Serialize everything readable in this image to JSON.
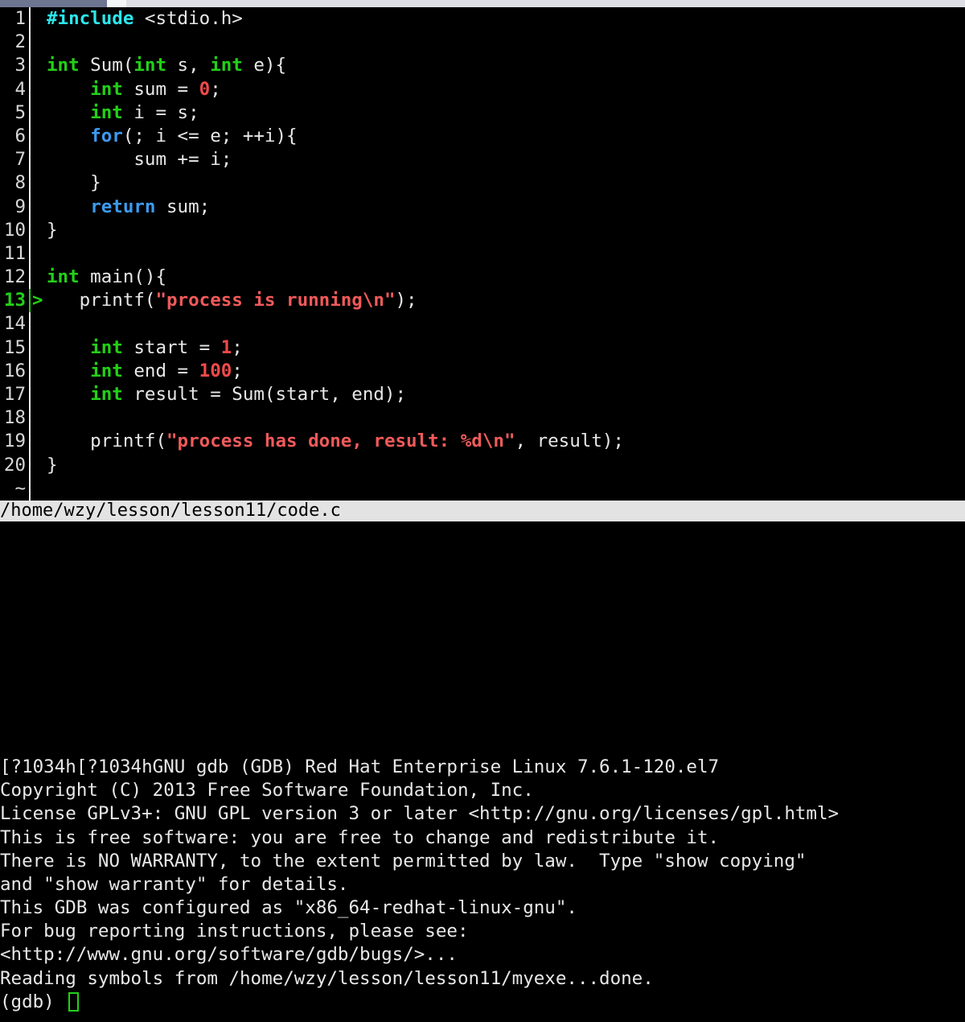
{
  "window": {
    "type": "terminal-gdb-tui",
    "background": "#000000",
    "foreground": "#e8e8e8"
  },
  "scrollbar": {
    "name": "horizontal-scrollbar",
    "thumb_color": "#6d7691",
    "track_color": "#dcdfe3"
  },
  "source_pane": {
    "file_label": "/home/wzy/lesson/lesson11/code.c",
    "current_line": 13,
    "marker": ">",
    "filler": "~",
    "lines": [
      {
        "num": "1",
        "current": false,
        "tokens": [
          {
            "c": "pre",
            "t": "#include"
          },
          {
            "c": "plain",
            "t": " <stdio.h>"
          }
        ]
      },
      {
        "num": "2",
        "current": false,
        "tokens": [
          {
            "c": "plain",
            "t": ""
          }
        ]
      },
      {
        "num": "3",
        "current": false,
        "tokens": [
          {
            "c": "type",
            "t": "int"
          },
          {
            "c": "plain",
            "t": " Sum("
          },
          {
            "c": "type",
            "t": "int"
          },
          {
            "c": "plain",
            "t": " s, "
          },
          {
            "c": "type",
            "t": "int"
          },
          {
            "c": "plain",
            "t": " e){"
          }
        ]
      },
      {
        "num": "4",
        "current": false,
        "tokens": [
          {
            "c": "plain",
            "t": "    "
          },
          {
            "c": "type",
            "t": "int"
          },
          {
            "c": "plain",
            "t": " sum = "
          },
          {
            "c": "num",
            "t": "0"
          },
          {
            "c": "plain",
            "t": ";"
          }
        ]
      },
      {
        "num": "5",
        "current": false,
        "tokens": [
          {
            "c": "plain",
            "t": "    "
          },
          {
            "c": "type",
            "t": "int"
          },
          {
            "c": "plain",
            "t": " i = s;"
          }
        ]
      },
      {
        "num": "6",
        "current": false,
        "tokens": [
          {
            "c": "plain",
            "t": "    "
          },
          {
            "c": "kw",
            "t": "for"
          },
          {
            "c": "plain",
            "t": "(; i <= e; ++i){"
          }
        ]
      },
      {
        "num": "7",
        "current": false,
        "tokens": [
          {
            "c": "plain",
            "t": "        sum += i;"
          }
        ]
      },
      {
        "num": "8",
        "current": false,
        "tokens": [
          {
            "c": "plain",
            "t": "    }"
          }
        ]
      },
      {
        "num": "9",
        "current": false,
        "tokens": [
          {
            "c": "plain",
            "t": "    "
          },
          {
            "c": "kw",
            "t": "return"
          },
          {
            "c": "plain",
            "t": " sum;"
          }
        ]
      },
      {
        "num": "10",
        "current": false,
        "tokens": [
          {
            "c": "plain",
            "t": "}"
          }
        ]
      },
      {
        "num": "11",
        "current": false,
        "tokens": [
          {
            "c": "plain",
            "t": ""
          }
        ]
      },
      {
        "num": "12",
        "current": false,
        "tokens": [
          {
            "c": "type",
            "t": "int"
          },
          {
            "c": "plain",
            "t": " main(){"
          }
        ]
      },
      {
        "num": "13",
        "current": true,
        "tokens": [
          {
            "c": "plain",
            "t": "   printf("
          },
          {
            "c": "str",
            "t": "\"process is running\\n\""
          },
          {
            "c": "plain",
            "t": ");"
          }
        ]
      },
      {
        "num": "14",
        "current": false,
        "tokens": [
          {
            "c": "plain",
            "t": ""
          }
        ]
      },
      {
        "num": "15",
        "current": false,
        "tokens": [
          {
            "c": "plain",
            "t": "    "
          },
          {
            "c": "type",
            "t": "int"
          },
          {
            "c": "plain",
            "t": " start = "
          },
          {
            "c": "num",
            "t": "1"
          },
          {
            "c": "plain",
            "t": ";"
          }
        ]
      },
      {
        "num": "16",
        "current": false,
        "tokens": [
          {
            "c": "plain",
            "t": "    "
          },
          {
            "c": "type",
            "t": "int"
          },
          {
            "c": "plain",
            "t": " end = "
          },
          {
            "c": "num",
            "t": "100"
          },
          {
            "c": "plain",
            "t": ";"
          }
        ]
      },
      {
        "num": "17",
        "current": false,
        "tokens": [
          {
            "c": "plain",
            "t": "    "
          },
          {
            "c": "type",
            "t": "int"
          },
          {
            "c": "plain",
            "t": " result = Sum(start, end);"
          }
        ]
      },
      {
        "num": "18",
        "current": false,
        "tokens": [
          {
            "c": "plain",
            "t": ""
          }
        ]
      },
      {
        "num": "19",
        "current": false,
        "tokens": [
          {
            "c": "plain",
            "t": "    printf("
          },
          {
            "c": "str",
            "t": "\"process has done, result: %d\\n\""
          },
          {
            "c": "plain",
            "t": ", result);"
          }
        ]
      },
      {
        "num": "20",
        "current": false,
        "tokens": [
          {
            "c": "plain",
            "t": "}"
          }
        ]
      }
    ]
  },
  "console": {
    "lines": [
      "[?1034h[?1034hGNU gdb (GDB) Red Hat Enterprise Linux 7.6.1-120.el7",
      "Copyright (C) 2013 Free Software Foundation, Inc.",
      "License GPLv3+: GNU GPL version 3 or later <http://gnu.org/licenses/gpl.html>",
      "This is free software: you are free to change and redistribute it.",
      "There is NO WARRANTY, to the extent permitted by law.  Type \"show copying\"",
      "and \"show warranty\" for details.",
      "This GDB was configured as \"x86_64-redhat-linux-gnu\".",
      "For bug reporting instructions, please see:",
      "<http://www.gnu.org/software/gdb/bugs/>...",
      "Reading symbols from /home/wzy/lesson/lesson11/myexe...done."
    ],
    "prompt": "(gdb) ",
    "input_value": "",
    "cursor_color": "#23d018"
  }
}
